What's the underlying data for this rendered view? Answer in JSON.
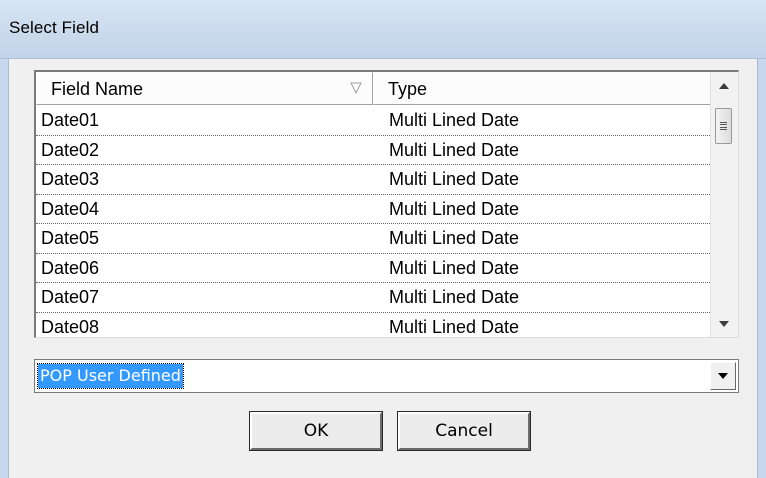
{
  "dialog": {
    "title": "Select Field"
  },
  "listview": {
    "columns": [
      "Field Name",
      "Type"
    ],
    "rows": [
      {
        "name": "Date01",
        "type": "Multi Lined Date"
      },
      {
        "name": "Date02",
        "type": "Multi Lined Date"
      },
      {
        "name": "Date03",
        "type": "Multi Lined Date"
      },
      {
        "name": "Date04",
        "type": "Multi Lined Date"
      },
      {
        "name": "Date05",
        "type": "Multi Lined Date"
      },
      {
        "name": "Date06",
        "type": "Multi Lined Date"
      },
      {
        "name": "Date07",
        "type": "Multi Lined Date"
      },
      {
        "name": "Date08",
        "type": "Multi Lined Date"
      }
    ]
  },
  "combo": {
    "selected": "POP User Defined"
  },
  "buttons": {
    "ok": "OK",
    "cancel": "Cancel"
  },
  "icons": {
    "sort": "sort-triangle-icon",
    "scroll_up": "scroll-up-arrow-icon",
    "scroll_down": "scroll-down-arrow-icon",
    "dropdown": "dropdown-arrow-icon"
  }
}
